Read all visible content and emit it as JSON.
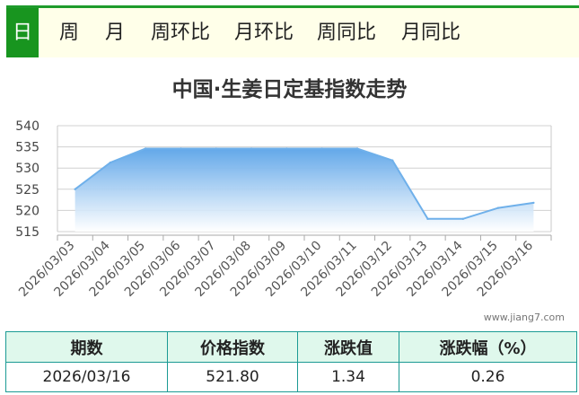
{
  "tabs": [
    {
      "label": "日",
      "active": true
    },
    {
      "label": "周",
      "active": false
    },
    {
      "label": "月",
      "active": false
    },
    {
      "label": "周环比",
      "active": false
    },
    {
      "label": "月环比",
      "active": false
    },
    {
      "label": "周同比",
      "active": false
    },
    {
      "label": "月同比",
      "active": false
    }
  ],
  "colors": {
    "tab_active": "#18951f",
    "accent": "#1e9b2b",
    "area_top": "#5aa3e8",
    "line": "#6fb0ea",
    "table_border": "#1b9a94"
  },
  "chart_data": {
    "type": "area",
    "title": "中国·生姜日定基指数走势",
    "x": [
      "2026/03/03",
      "2026/03/04",
      "2026/03/05",
      "2026/03/06",
      "2026/03/07",
      "2026/03/08",
      "2026/03/09",
      "2026/03/10",
      "2026/03/11",
      "2026/03/12",
      "2026/03/13",
      "2026/03/14",
      "2026/03/15",
      "2026/03/16"
    ],
    "y": [
      525.0,
      531.3,
      534.6,
      534.6,
      534.6,
      534.6,
      534.6,
      534.6,
      534.6,
      531.8,
      518.0,
      518.0,
      520.6,
      521.8
    ],
    "yticks": [
      515,
      520,
      525,
      530,
      535,
      540
    ],
    "ylim": [
      515,
      540
    ],
    "grid": true
  },
  "watermark": "www.jiang7.com",
  "summary": {
    "headers": [
      "期数",
      "价格指数",
      "涨跌值",
      "涨跌幅（%）"
    ],
    "row": [
      "2026/03/16",
      "521.80",
      "1.34",
      "0.26"
    ]
  }
}
